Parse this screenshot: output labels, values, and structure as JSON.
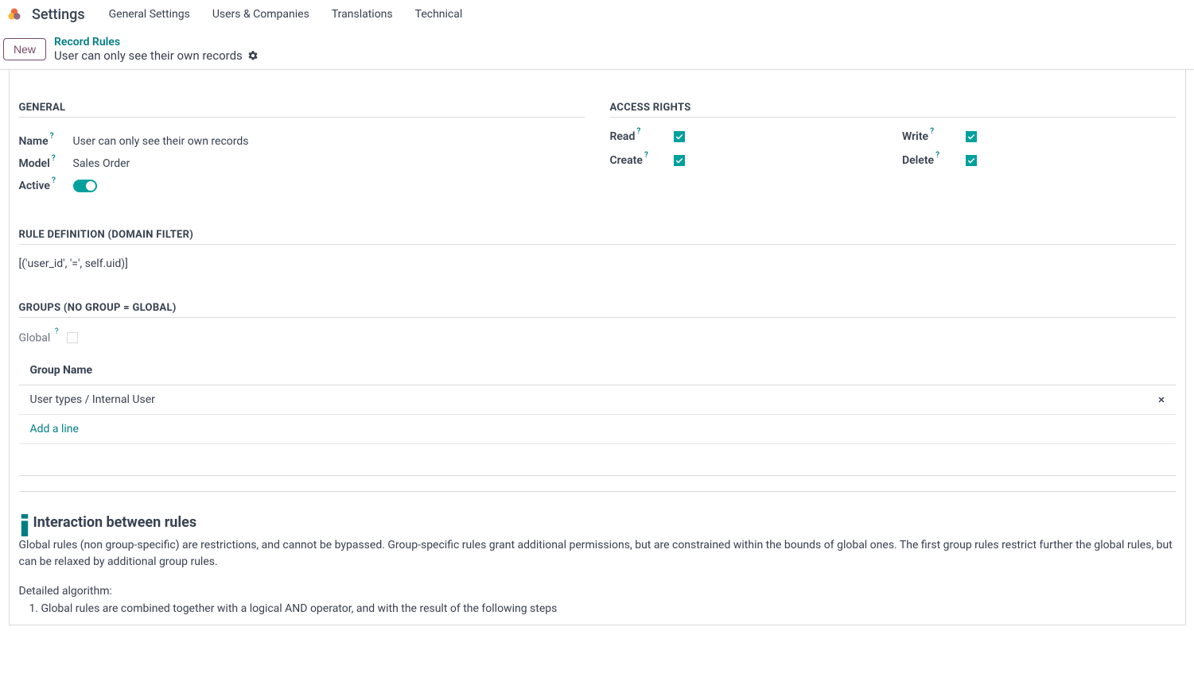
{
  "nav": {
    "app": "Settings",
    "menus": [
      "General Settings",
      "Users & Companies",
      "Translations",
      "Technical"
    ]
  },
  "control": {
    "new_btn": "New",
    "breadcrumb_parent": "Record Rules",
    "breadcrumb_current": "User can only see their own records"
  },
  "sections": {
    "general": "GENERAL",
    "access": "ACCESS RIGHTS",
    "rule_def": "RULE DEFINITION (DOMAIN FILTER)",
    "groups": "GROUPS (NO GROUP = GLOBAL)"
  },
  "fields": {
    "name_label": "Name",
    "name_value": "User can only see their own records",
    "model_label": "Model",
    "model_value": "Sales Order",
    "active_label": "Active",
    "active_value": true
  },
  "access": {
    "read": "Read",
    "write": "Write",
    "create": "Create",
    "delete": "Delete",
    "read_v": true,
    "write_v": true,
    "create_v": true,
    "delete_v": true
  },
  "domain": "[('user_id', '=', self.uid)]",
  "groups": {
    "global_label": "Global",
    "global_checked": false,
    "header": "Group Name",
    "rows": [
      "User types / Internal User"
    ],
    "add_line": "Add a line"
  },
  "info": {
    "title": "Interaction between rules",
    "body": "Global rules (non group-specific) are restrictions, and cannot be bypassed. Group-specific rules grant additional permissions, but are constrained within the bounds of global ones. The first group rules restrict further the global rules, but can be relaxed by additional group rules.",
    "detailed": "Detailed algorithm:",
    "step1": "Global rules are combined together with a logical AND operator, and with the result of the following steps"
  },
  "help": "?"
}
